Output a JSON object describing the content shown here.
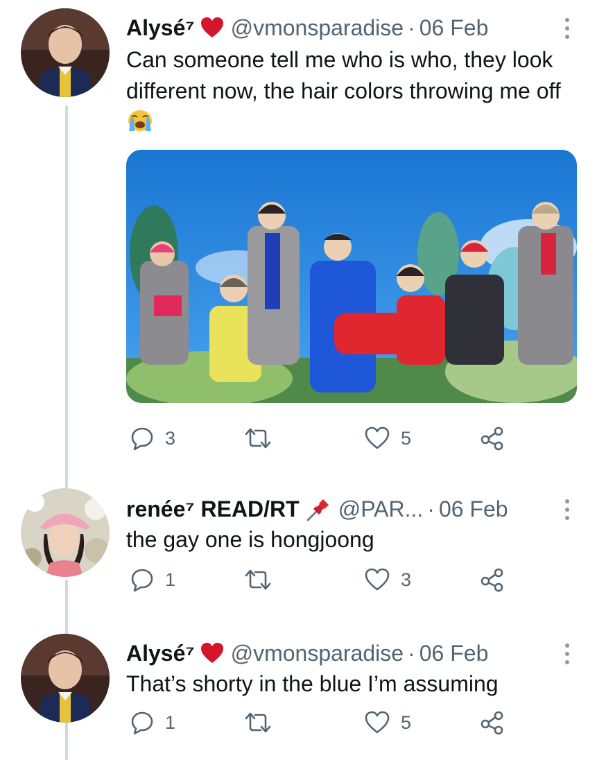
{
  "tweets": [
    {
      "name": "Alysé⁷",
      "handle": "@vmonsparadise",
      "separator": "·",
      "date": "06 Feb",
      "text": "Can someone tell me who is who, they look different now, the hair colors throwing me off",
      "emoji": "loudly-crying-face",
      "replies": "3",
      "retweets": "",
      "likes": "5",
      "has_media": true
    },
    {
      "name": "renée⁷ READ/RT",
      "handle": "@PAR...",
      "separator": "·",
      "date": "06 Feb",
      "text": "the gay one is hongjoong",
      "emoji": "pushpin",
      "replies": "1",
      "retweets": "",
      "likes": "3"
    },
    {
      "name": "Alysé⁷",
      "handle": "@vmonsparadise",
      "separator": "·",
      "date": "06 Feb",
      "text": "That’s shorty in the blue I’m assuming",
      "emoji": "red-heart",
      "replies": "1",
      "retweets": "",
      "likes": "5"
    }
  ],
  "colors": {
    "text": "#0f1419",
    "secondary": "#536471",
    "thread_line": "#cfd9de",
    "heart": "#e0245e",
    "media_sky": "#1e88e5"
  }
}
